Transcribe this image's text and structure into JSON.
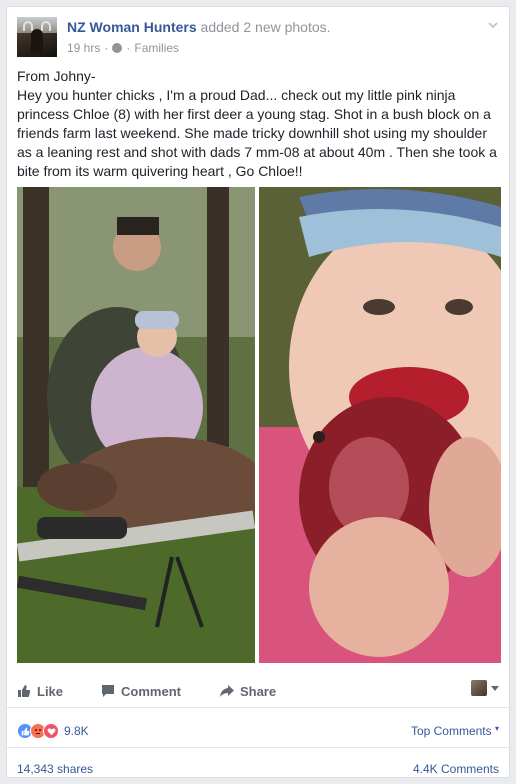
{
  "header": {
    "page_name": "NZ Woman Hunters",
    "action_text": " added 2 new photos.",
    "time": "19 hrs",
    "separator": "·",
    "audience": "Families"
  },
  "post": {
    "text": "From Johny-\nHey you hunter chicks , I'm a proud Dad... check out my little pink ninja princess Chloe (8) with her first deer a young stag. Shot in a bush block on a friends farm last weekend. She made tricky downhill shot using my shoulder as a leaning rest and shot with dads 7 mm-08 at about 40m . Then she took a bite from its warm quivering heart , Go Chloe!!"
  },
  "actions": {
    "like": "Like",
    "comment": "Comment",
    "share": "Share"
  },
  "reactions": {
    "count": "9.8K",
    "top_comments": "Top Comments",
    "types": [
      "like-icon",
      "angry-icon",
      "love-icon"
    ]
  },
  "stats": {
    "shares": "14,343 shares",
    "comments": "4.4K Comments"
  },
  "colors": {
    "link": "#365899",
    "muted": "#90949c",
    "action": "#616770",
    "like": "#5890ff",
    "angry": "#f7714c",
    "love": "#f25268"
  }
}
